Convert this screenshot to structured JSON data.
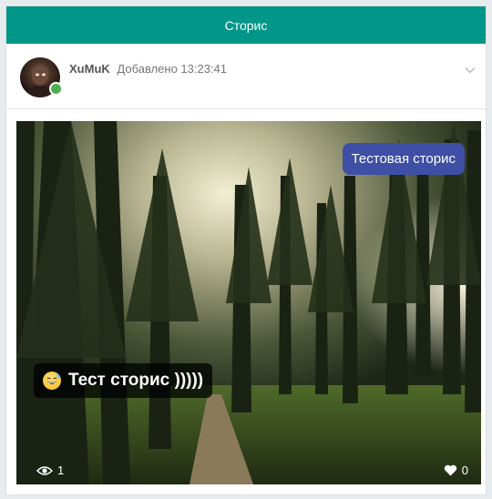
{
  "topbar": {
    "title": "Сторис"
  },
  "post": {
    "username": "XuMuK",
    "added_label": "Добавлено 13:23:41",
    "menu_icon": "chevron-down-icon",
    "avatar_icon": "avatar",
    "online_color": "#4caf50"
  },
  "story": {
    "title": "Тестовая сторис",
    "caption": "Тест сторис )))))",
    "caption_emoji": "grinning-sweat-emoji",
    "views": "1",
    "likes": "0",
    "views_icon": "eye-icon",
    "likes_icon": "heart-icon"
  },
  "colors": {
    "accent": "#009688",
    "title_badge": "#3f4fa6"
  }
}
